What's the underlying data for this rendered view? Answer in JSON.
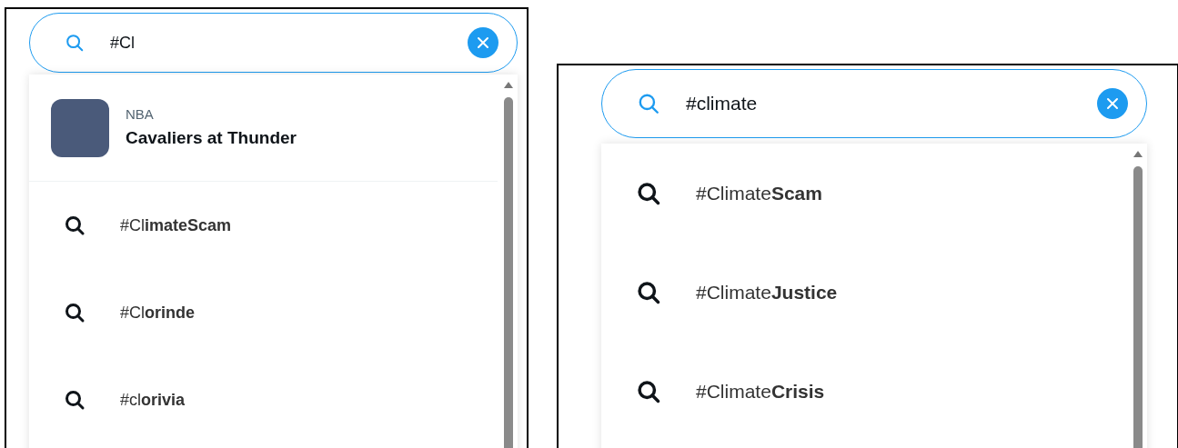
{
  "panels": [
    {
      "search": {
        "value": "#Cl"
      },
      "results": [
        {
          "kind": "event",
          "category": "NBA",
          "title": "Cavaliers at Thunder"
        },
        {
          "kind": "suggestion",
          "text": "#Cl**imateScam**"
        },
        {
          "kind": "suggestion",
          "text": "#Cl**orinde**"
        },
        {
          "kind": "suggestion",
          "text": "#cl**orivia**"
        }
      ]
    },
    {
      "search": {
        "value": "#climate"
      },
      "results": [
        {
          "kind": "suggestion",
          "text": "#Climate**Scam**"
        },
        {
          "kind": "suggestion",
          "text": "#Climate**Justice**"
        },
        {
          "kind": "suggestion",
          "text": "#Climate**Crisis**"
        }
      ]
    }
  ]
}
